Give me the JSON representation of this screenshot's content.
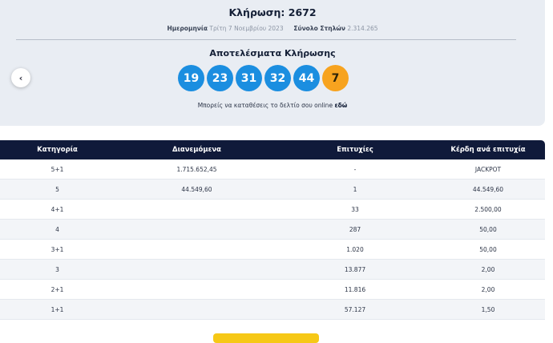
{
  "draw": {
    "title": "Κλήρωση: 2672",
    "date_label": "Ημερομηνία",
    "date_value": "Τρίτη 7 Νοεμβρίου 2023",
    "columns_label": "Σύνολο Στηλών",
    "columns_value": "2.314.265",
    "results_title": "Αποτελέσματα Κλήρωσης",
    "numbers": [
      "19",
      "23",
      "31",
      "32",
      "44"
    ],
    "bonus": "7",
    "bet_text": "Μπορείς να καταθέσεις το δελτίο σου online",
    "bet_link": "εδώ",
    "prev_arrow": "‹"
  },
  "colors": {
    "ball": "#1b8ee0",
    "bonus_ball": "#f7a31f",
    "header": "#101a3a",
    "card": "#e9edf3",
    "cta": "#f6c816"
  },
  "table": {
    "headers": [
      "Κατηγορία",
      "Διανεμόμενα",
      "Επιτυχίες",
      "Κέρδη ανά επιτυχία"
    ],
    "rows": [
      [
        "5+1",
        "1.715.652,45",
        "-",
        "JACKPOT"
      ],
      [
        "5",
        "44.549,60",
        "1",
        "44.549,60"
      ],
      [
        "4+1",
        "",
        "33",
        "2.500,00"
      ],
      [
        "4",
        "",
        "287",
        "50,00"
      ],
      [
        "3+1",
        "",
        "1.020",
        "50,00"
      ],
      [
        "3",
        "",
        "13.877",
        "2,00"
      ],
      [
        "2+1",
        "",
        "11.816",
        "2,00"
      ],
      [
        "1+1",
        "",
        "57.127",
        "1,50"
      ]
    ]
  }
}
